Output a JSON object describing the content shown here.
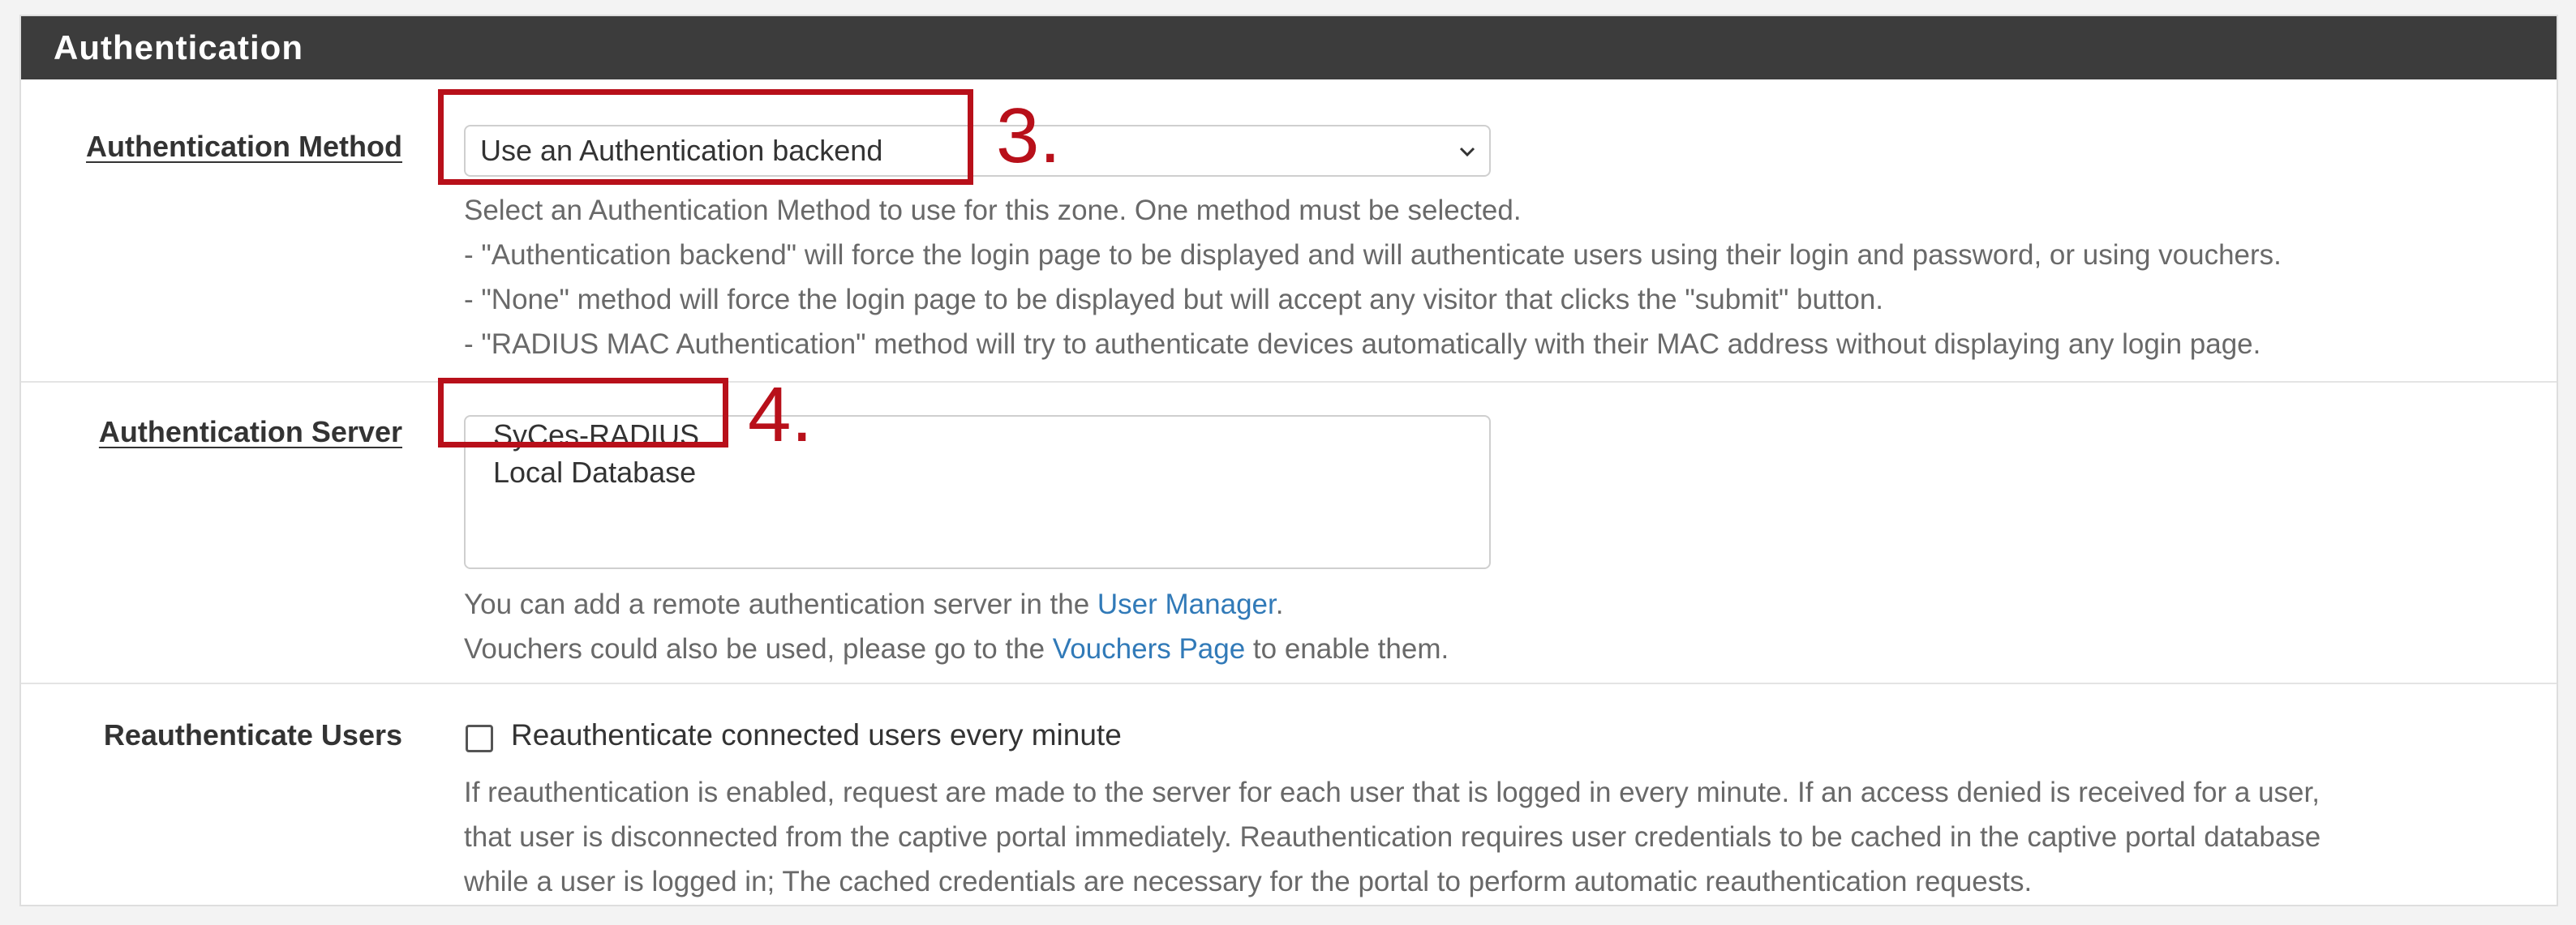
{
  "panel": {
    "title": "Authentication"
  },
  "auth_method": {
    "label": "Authentication Method",
    "selected": "Use an Authentication backend",
    "help": [
      "Select an Authentication Method to use for this zone. One method must be selected.",
      "- \"Authentication backend\" will force the login page to be displayed and will authenticate users using their login and password, or using vouchers.",
      "- \"None\" method will force the login page to be displayed but will accept any visitor that clicks the \"submit\" button.",
      "- \"RADIUS MAC Authentication\" method will try to authenticate devices automatically with their MAC address without displaying any login page."
    ]
  },
  "auth_server": {
    "label": "Authentication Server",
    "options": [
      "SyCes-RADIUS",
      "Local Database"
    ],
    "help1_prefix": "You can add a remote authentication server in the ",
    "help1_link": "User Manager",
    "help1_suffix": ".",
    "help2_prefix": "Vouchers could also be used, please go to the ",
    "help2_link": "Vouchers Page",
    "help2_suffix": " to enable them."
  },
  "reauth": {
    "label": "Reauthenticate Users",
    "checkbox_label": "Reauthenticate connected users every minute",
    "checked": false,
    "help": [
      "If reauthentication is enabled, request are made to the server for each user that is logged in every minute. If an access denied is received for a user,",
      "that user is disconnected from the captive portal immediately. Reauthentication requires user credentials to be cached in the captive portal database",
      "while a user is logged in; The cached credentials are necessary for the portal to perform automatic reauthentication requests."
    ]
  },
  "annotations": {
    "step3": "3.",
    "step4": "4."
  },
  "colors": {
    "header_bg": "#3c3c3c",
    "link": "#317ab8",
    "callout": "#b8101a"
  }
}
